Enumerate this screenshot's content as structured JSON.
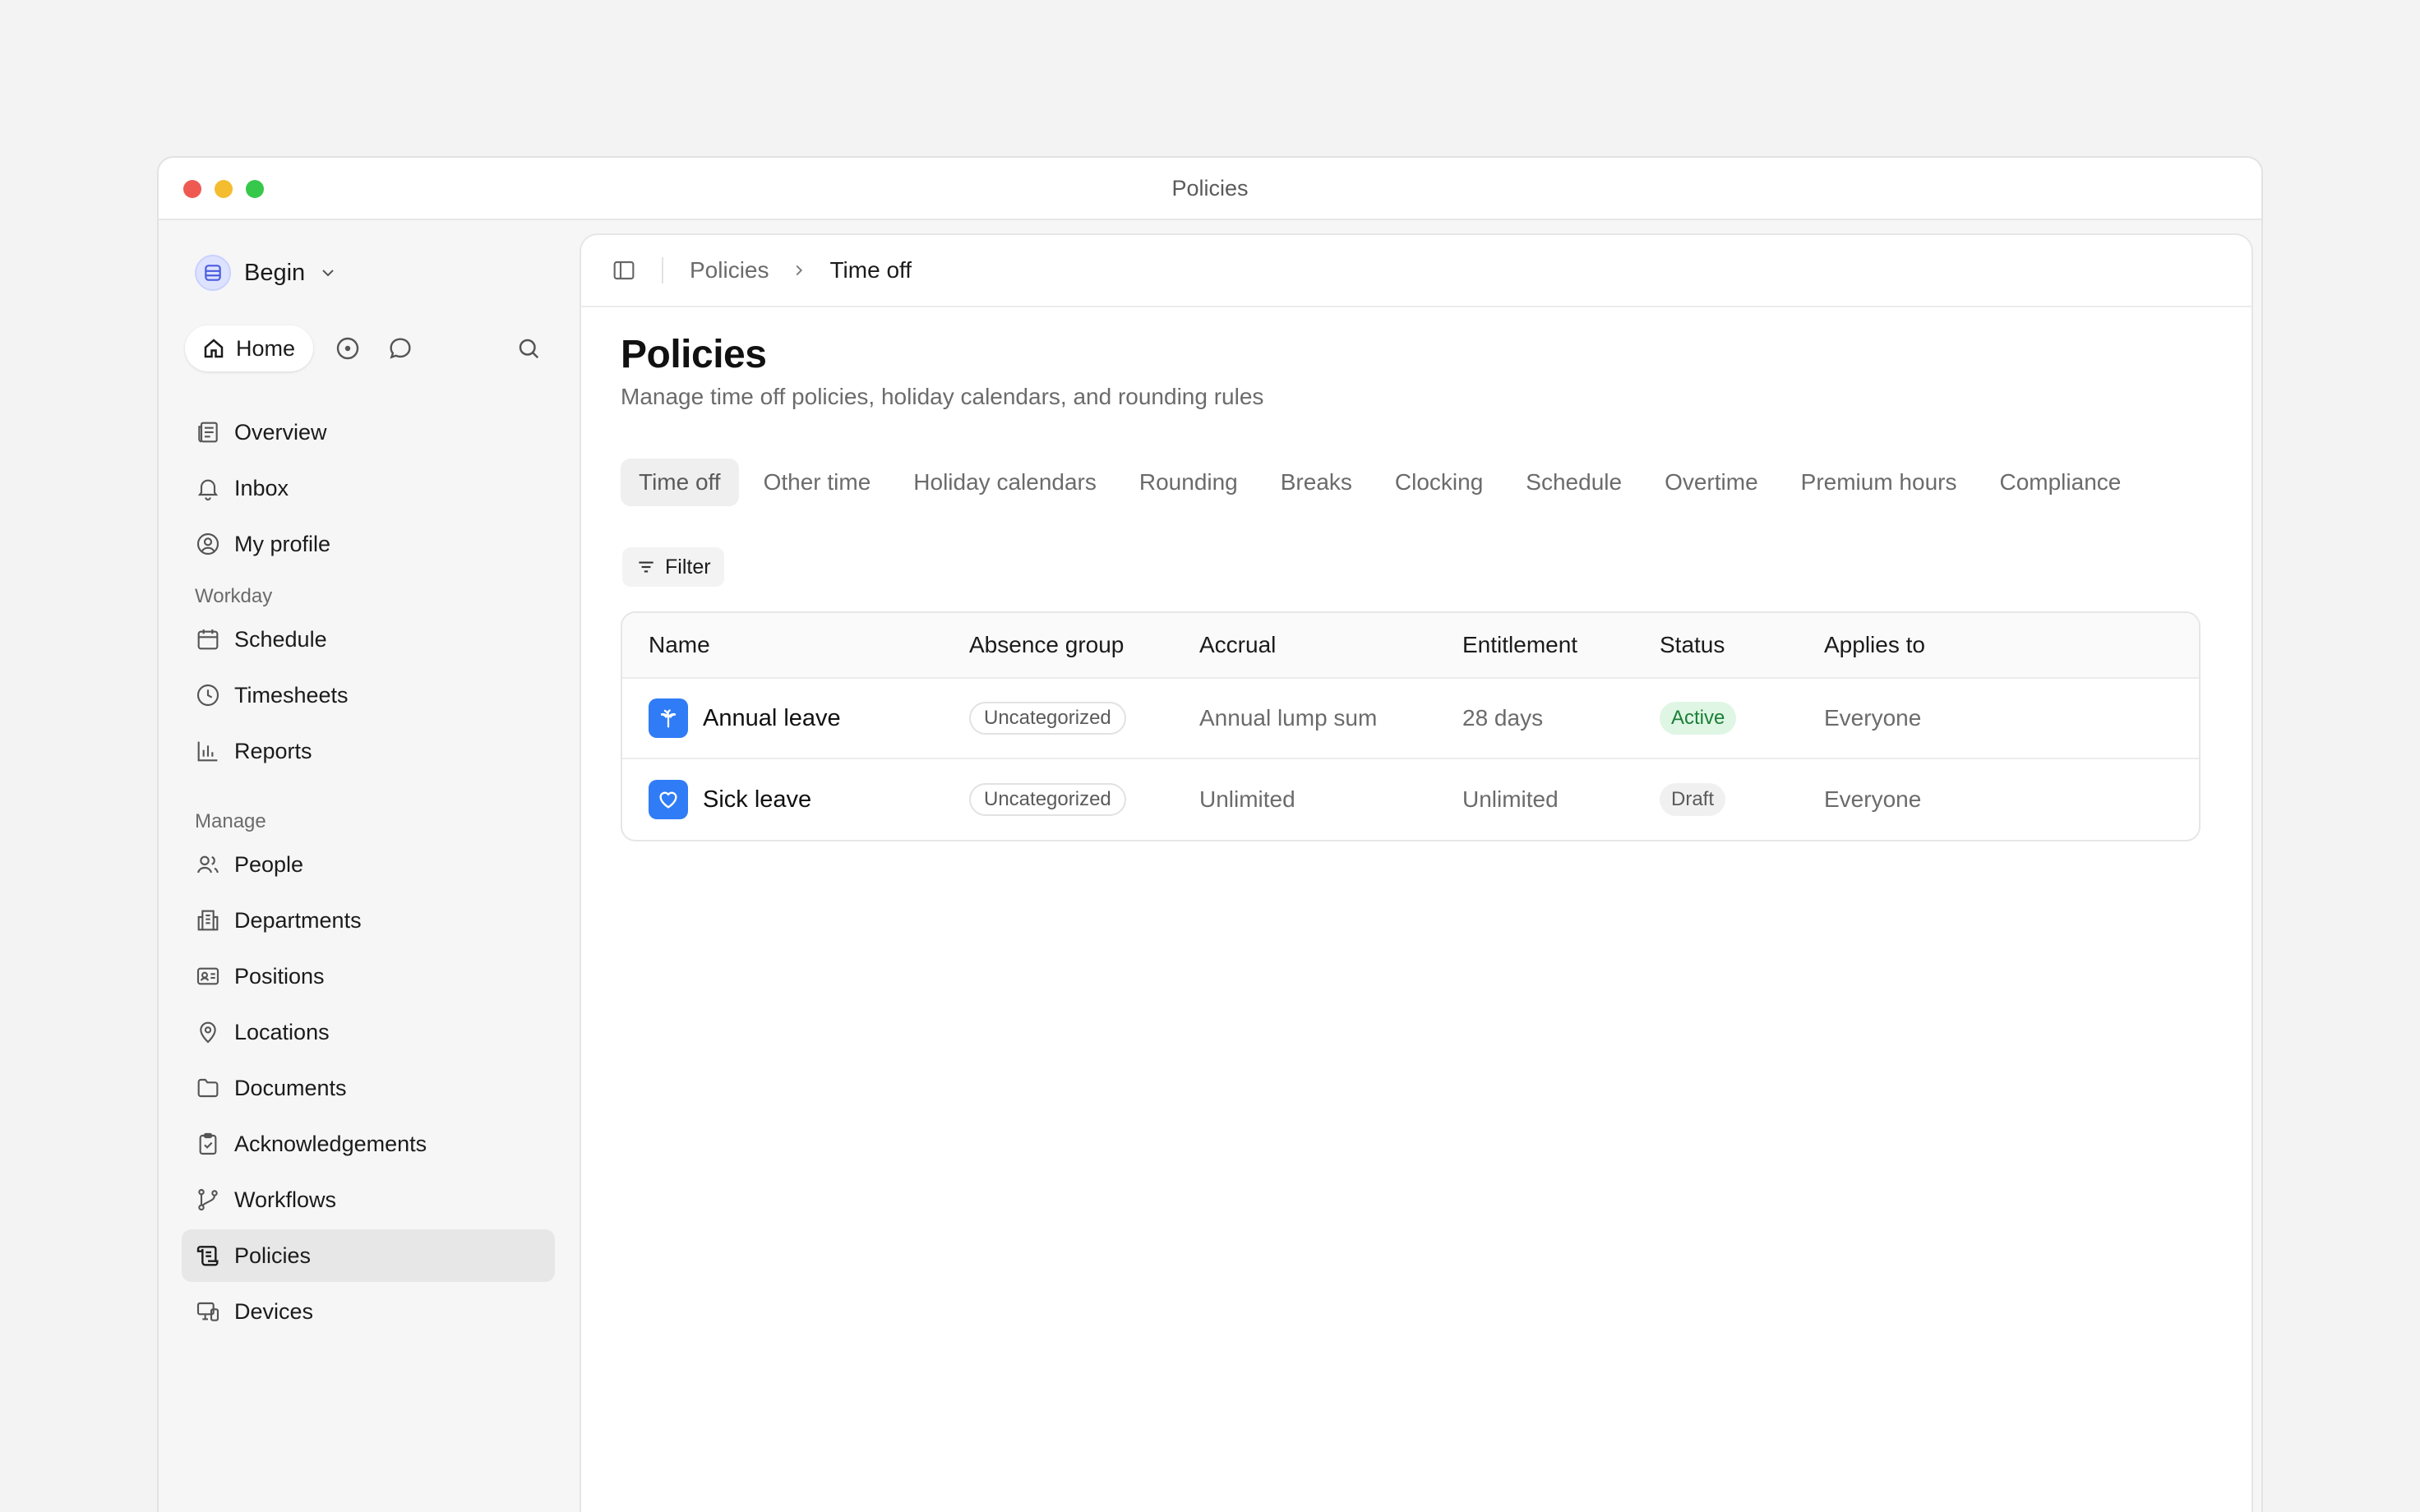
{
  "window": {
    "title": "Policies"
  },
  "sidebar": {
    "workspace_name": "Begin",
    "home_label": "Home",
    "items_top": [
      {
        "label": "Overview",
        "icon": "newspaper-icon"
      },
      {
        "label": "Inbox",
        "icon": "bell-icon"
      },
      {
        "label": "My profile",
        "icon": "user-circle-icon"
      }
    ],
    "section_workday": "Workday",
    "items_workday": [
      {
        "label": "Schedule",
        "icon": "calendar-icon"
      },
      {
        "label": "Timesheets",
        "icon": "clock-icon"
      },
      {
        "label": "Reports",
        "icon": "bar-chart-icon"
      }
    ],
    "section_manage": "Manage",
    "items_manage": [
      {
        "label": "People",
        "icon": "users-icon"
      },
      {
        "label": "Departments",
        "icon": "building-icon"
      },
      {
        "label": "Positions",
        "icon": "id-card-icon"
      },
      {
        "label": "Locations",
        "icon": "map-pin-icon"
      },
      {
        "label": "Documents",
        "icon": "folder-icon"
      },
      {
        "label": "Acknowledgements",
        "icon": "clipboard-check-icon"
      },
      {
        "label": "Workflows",
        "icon": "git-branch-icon"
      },
      {
        "label": "Policies",
        "icon": "scroll-icon",
        "active": true
      },
      {
        "label": "Devices",
        "icon": "devices-icon"
      }
    ]
  },
  "breadcrumb": {
    "parent": "Policies",
    "current": "Time off"
  },
  "page": {
    "title": "Policies",
    "subtitle": "Manage time off policies, holiday calendars, and rounding rules"
  },
  "tabs": [
    {
      "label": "Time off",
      "active": true
    },
    {
      "label": "Other time"
    },
    {
      "label": "Holiday calendars"
    },
    {
      "label": "Rounding"
    },
    {
      "label": "Breaks"
    },
    {
      "label": "Clocking"
    },
    {
      "label": "Schedule"
    },
    {
      "label": "Overtime"
    },
    {
      "label": "Premium hours"
    },
    {
      "label": "Compliance"
    }
  ],
  "filter_label": "Filter",
  "table": {
    "headers": [
      "Name",
      "Absence group",
      "Accrual",
      "Entitlement",
      "Status",
      "Applies to"
    ],
    "rows": [
      {
        "name": "Annual leave",
        "icon": "palm-tree-icon",
        "group": "Uncategorized",
        "accrual": "Annual lump sum",
        "entitlement": "28 days",
        "status": "Active",
        "applies_to": "Everyone"
      },
      {
        "name": "Sick leave",
        "icon": "heart-icon",
        "group": "Uncategorized",
        "accrual": "Unlimited",
        "entitlement": "Unlimited",
        "status": "Draft",
        "applies_to": "Everyone"
      }
    ]
  },
  "colors": {
    "accent": "#2f7cf6",
    "active_badge_bg": "#dff6e4",
    "active_badge_text": "#1a7f37",
    "nav_active_bg": "#e7e7e7"
  }
}
